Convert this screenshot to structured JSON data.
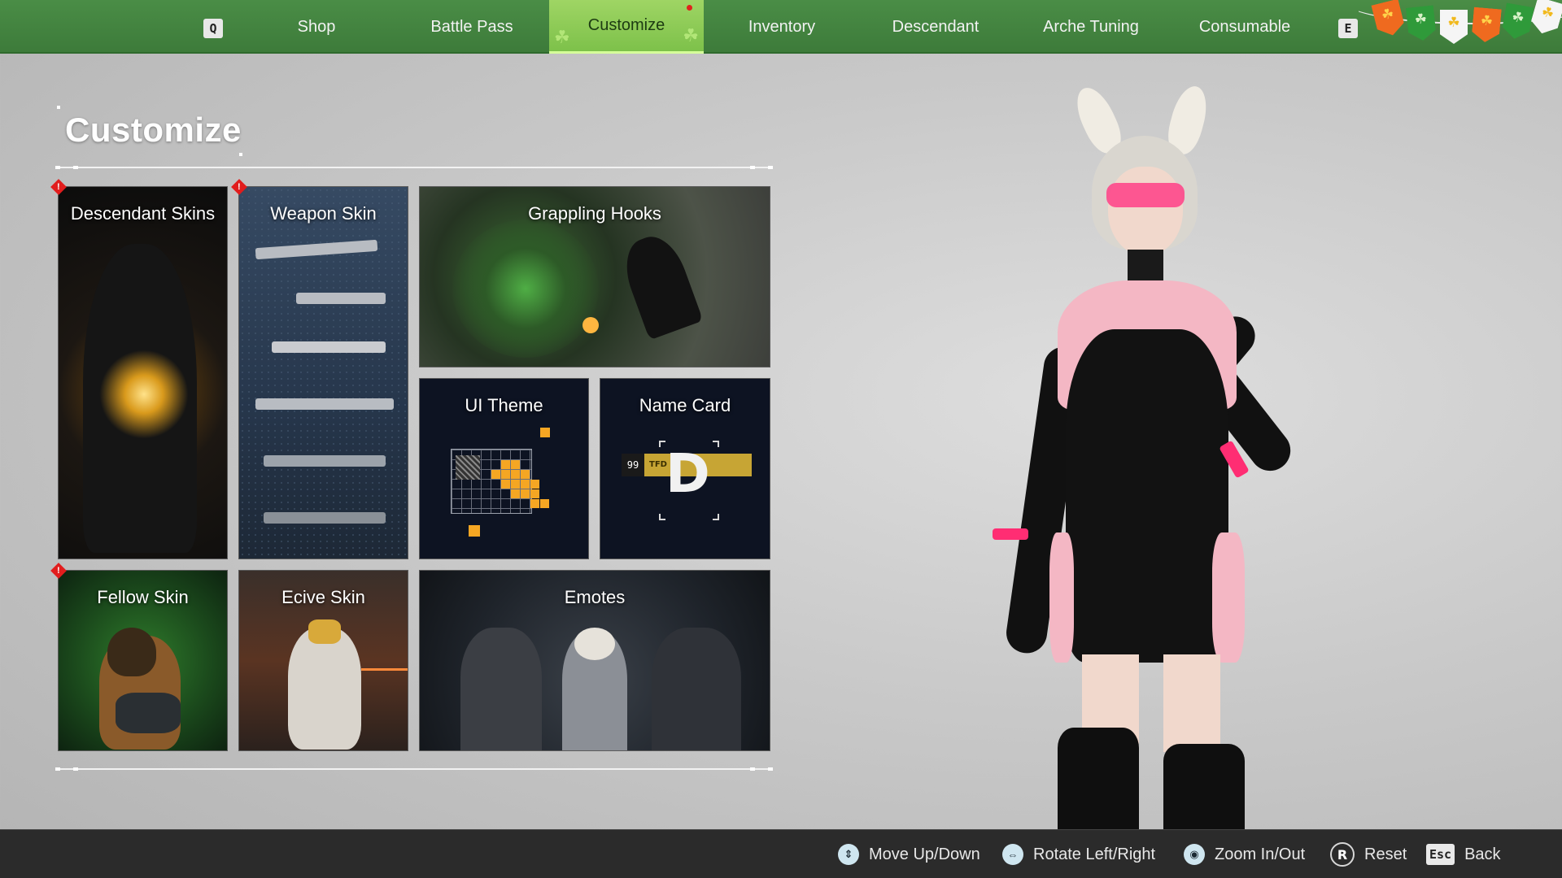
{
  "nav": {
    "left_key": "Q",
    "right_key": "E",
    "tabs": [
      {
        "label": "Shop"
      },
      {
        "label": "Battle Pass"
      },
      {
        "label": "Customize"
      },
      {
        "label": "Inventory"
      },
      {
        "label": "Descendant"
      },
      {
        "label": "Arche Tuning"
      },
      {
        "label": "Consumable"
      }
    ],
    "active_tab": "Customize",
    "accent_color": "#7dc14a",
    "bar_color": "#3d7b3a"
  },
  "page": {
    "title": "Customize"
  },
  "tiles": [
    {
      "label": "Descendant Skins",
      "alert": true
    },
    {
      "label": "Weapon Skin",
      "alert": true
    },
    {
      "label": "Grappling Hooks",
      "alert": false
    },
    {
      "label": "UI Theme",
      "alert": false
    },
    {
      "label": "Name Card",
      "alert": false
    },
    {
      "label": "Fellow Skin",
      "alert": true
    },
    {
      "label": "Ecive Skin",
      "alert": false
    },
    {
      "label": "Emotes",
      "alert": false
    }
  ],
  "name_card": {
    "level": "99",
    "tag": "TFD",
    "letter": "D"
  },
  "alert_glyph": "!",
  "hints": [
    {
      "icon": "mouse-up-down-icon",
      "label": "Move Up/Down"
    },
    {
      "icon": "mouse-drag-icon",
      "label": "Rotate Left/Right"
    },
    {
      "icon": "mouse-wheel-icon",
      "label": "Zoom In/Out"
    },
    {
      "key": "R",
      "label": "Reset"
    },
    {
      "key": "Esc",
      "label": "Back"
    }
  ],
  "alert_color": "#e11d1d"
}
